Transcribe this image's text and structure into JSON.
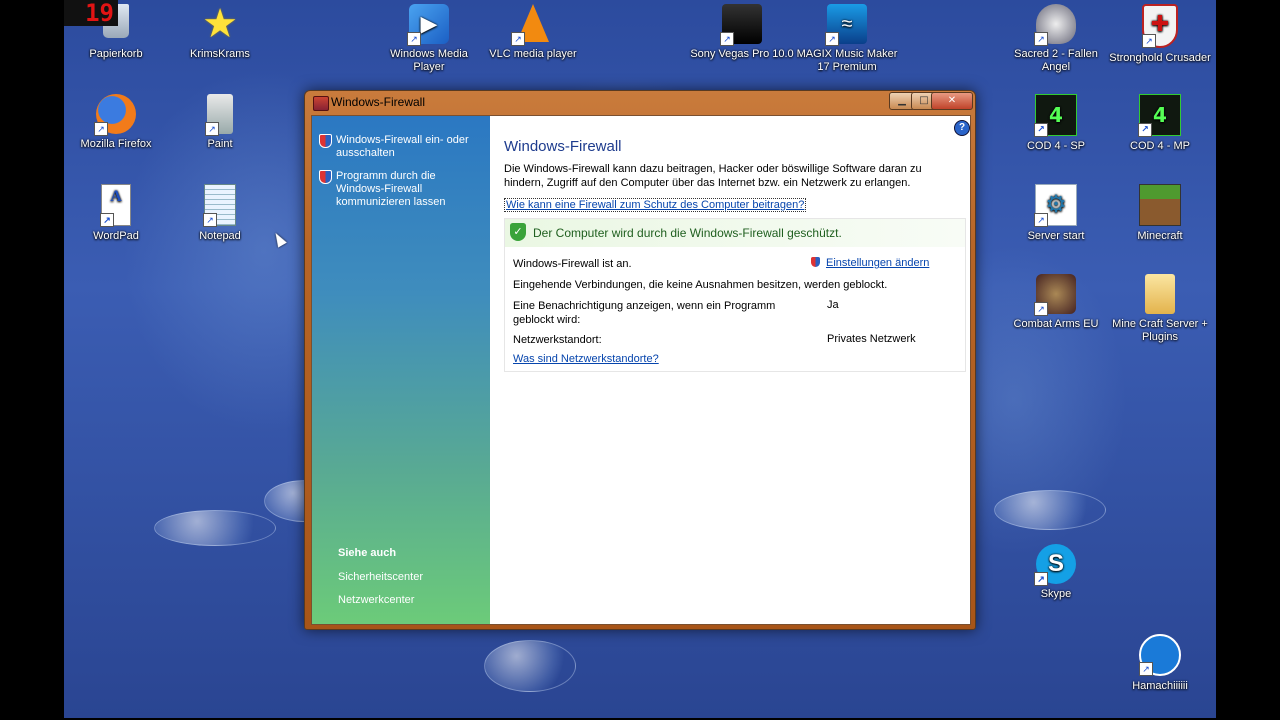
{
  "recording_counter": "19",
  "desktop_icons": [
    {
      "label": "Papierkorb"
    },
    {
      "label": "KrimsKrams"
    },
    {
      "label": "Windows Media Player"
    },
    {
      "label": "VLC media player"
    },
    {
      "label": "Sony Vegas Pro 10.0"
    },
    {
      "label": "MAGIX Music Maker 17 Premium"
    },
    {
      "label": "Sacred 2 - Fallen Angel"
    },
    {
      "label": "Stronghold Crusader"
    },
    {
      "label": "Mozilla Firefox"
    },
    {
      "label": "Paint"
    },
    {
      "label": "COD 4 - SP"
    },
    {
      "label": "COD 4 - MP"
    },
    {
      "label": "WordPad"
    },
    {
      "label": "Notepad"
    },
    {
      "label": "Server start"
    },
    {
      "label": "Minecraft"
    },
    {
      "label": "Combat Arms EU"
    },
    {
      "label": "Mine Craft Server + Plugins"
    },
    {
      "label": "Skype"
    },
    {
      "label": "Hamachiiiiii"
    }
  ],
  "window": {
    "title": "Windows-Firewall",
    "minimize_glyph": "▁",
    "maximize_glyph": "□",
    "close_glyph": "✕",
    "nav": {
      "links": [
        {
          "label": "Windows-Firewall ein- oder ausschalten"
        },
        {
          "label": "Programm durch die Windows-Firewall kommunizieren lassen"
        }
      ],
      "see_also_heading": "Siehe auch",
      "see_also": [
        {
          "label": "Sicherheitscenter"
        },
        {
          "label": "Netzwerkcenter"
        }
      ]
    },
    "main": {
      "help_glyph": "?",
      "heading": "Windows-Firewall",
      "description": "Die Windows-Firewall kann dazu beitragen, Hacker oder böswillige Software daran zu hindern, Zugriff auf den Computer über das Internet bzw. ein Netzwerk zu erlangen.",
      "help_link": "Wie kann eine Firewall zum Schutz des Computer beitragen?",
      "status": {
        "message": "Der Computer wird durch die Windows-Firewall geschützt.",
        "check_glyph": "✓",
        "firewall_state": "Windows-Firewall ist an.",
        "settings_link": "Einstellungen ändern",
        "incoming": "Eingehende Verbindungen, die keine Ausnahmen besitzen, werden geblockt.",
        "notify_label": "Eine Benachrichtigung anzeigen, wenn ein Programm geblockt wird:",
        "notify_value": "Ja",
        "location_label": "Netzwerkstandort:",
        "location_value": "Privates Netzwerk",
        "location_link": "Was sind Netzwerkstandorte?"
      }
    }
  }
}
